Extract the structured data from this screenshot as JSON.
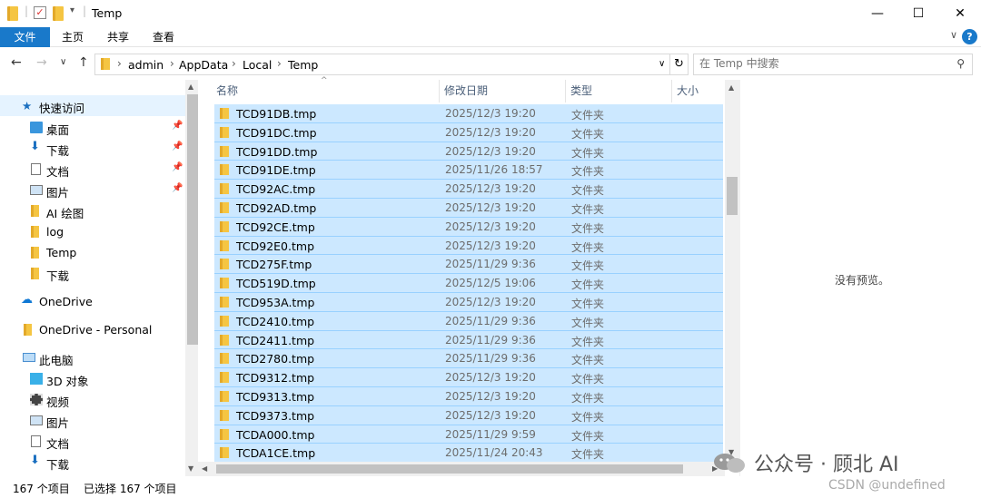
{
  "window": {
    "title": "Temp"
  },
  "ribbon": {
    "file_tab": "文件",
    "tabs": [
      "主页",
      "共享",
      "查看"
    ],
    "help": "?"
  },
  "address": {
    "crumbs": [
      "admin",
      "AppData",
      "Local",
      "Temp"
    ],
    "search_placeholder": "在 Temp 中搜索"
  },
  "nav": {
    "quick_access": "快速访问",
    "pinned": [
      {
        "label": "桌面",
        "icon": "desktop-icon"
      },
      {
        "label": "下载",
        "icon": "download-icon"
      },
      {
        "label": "文档",
        "icon": "document-icon"
      },
      {
        "label": "图片",
        "icon": "picture-icon"
      }
    ],
    "folders": [
      "AI 绘图",
      "log",
      "Temp",
      "下载"
    ],
    "onedrive": "OneDrive",
    "onedrive_personal": "OneDrive - Personal",
    "this_pc": "此电脑",
    "pc_items": [
      {
        "label": "3D 对象",
        "icon": "3d-objects-icon"
      },
      {
        "label": "视频",
        "icon": "video-icon"
      },
      {
        "label": "图片",
        "icon": "picture-icon"
      },
      {
        "label": "文档",
        "icon": "document-icon"
      },
      {
        "label": "下载",
        "icon": "download-icon"
      }
    ]
  },
  "columns": {
    "name": "名称",
    "modified": "修改日期",
    "type": "类型",
    "size": "大小"
  },
  "files": [
    {
      "name": "TCD91DB.tmp",
      "date": "2025/12/3 19:20",
      "type": "文件夹"
    },
    {
      "name": "TCD91DC.tmp",
      "date": "2025/12/3 19:20",
      "type": "文件夹"
    },
    {
      "name": "TCD91DD.tmp",
      "date": "2025/12/3 19:20",
      "type": "文件夹"
    },
    {
      "name": "TCD91DE.tmp",
      "date": "2025/11/26 18:57",
      "type": "文件夹"
    },
    {
      "name": "TCD92AC.tmp",
      "date": "2025/12/3 19:20",
      "type": "文件夹"
    },
    {
      "name": "TCD92AD.tmp",
      "date": "2025/12/3 19:20",
      "type": "文件夹"
    },
    {
      "name": "TCD92CE.tmp",
      "date": "2025/12/3 19:20",
      "type": "文件夹"
    },
    {
      "name": "TCD92E0.tmp",
      "date": "2025/12/3 19:20",
      "type": "文件夹"
    },
    {
      "name": "TCD275F.tmp",
      "date": "2025/11/29 9:36",
      "type": "文件夹"
    },
    {
      "name": "TCD519D.tmp",
      "date": "2025/12/5 19:06",
      "type": "文件夹"
    },
    {
      "name": "TCD953A.tmp",
      "date": "2025/12/3 19:20",
      "type": "文件夹"
    },
    {
      "name": "TCD2410.tmp",
      "date": "2025/11/29 9:36",
      "type": "文件夹"
    },
    {
      "name": "TCD2411.tmp",
      "date": "2025/11/29 9:36",
      "type": "文件夹"
    },
    {
      "name": "TCD2780.tmp",
      "date": "2025/11/29 9:36",
      "type": "文件夹"
    },
    {
      "name": "TCD9312.tmp",
      "date": "2025/12/3 19:20",
      "type": "文件夹"
    },
    {
      "name": "TCD9313.tmp",
      "date": "2025/12/3 19:20",
      "type": "文件夹"
    },
    {
      "name": "TCD9373.tmp",
      "date": "2025/12/3 19:20",
      "type": "文件夹"
    },
    {
      "name": "TCDA000.tmp",
      "date": "2025/11/29 9:59",
      "type": "文件夹"
    },
    {
      "name": "TCDA1CE.tmp",
      "date": "2025/11/24 20:43",
      "type": "文件夹"
    }
  ],
  "preview": {
    "empty_text": "没有预览。"
  },
  "status": {
    "count": "167 个项目",
    "selected": "已选择 167 个项目"
  },
  "watermark": {
    "main": "公众号 · 顾北 AI",
    "sub": "CSDN @undefined"
  },
  "colors": {
    "accent": "#1979ca",
    "selection": "#cce8ff",
    "folder": "#f5c542"
  }
}
